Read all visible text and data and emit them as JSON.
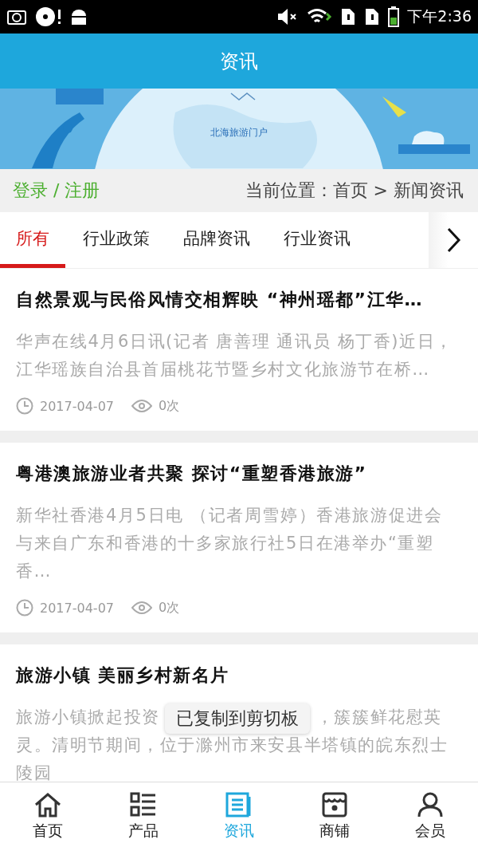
{
  "status_bar": {
    "time": "下午2:36"
  },
  "header": {
    "title": "资讯"
  },
  "banner": {
    "kind": "picture",
    "caption": "北海旅游门户"
  },
  "breadcrumb": {
    "login": "登录 / 注册",
    "location": "当前位置：首页 > 新闻资讯"
  },
  "tabs": [
    {
      "label": "所有",
      "selected": true
    },
    {
      "label": "行业政策",
      "selected": false
    },
    {
      "label": "品牌资讯",
      "selected": false
    },
    {
      "label": "行业资讯",
      "selected": false
    }
  ],
  "articles": [
    {
      "title": "自然景观与民俗风情交相辉映 “神州瑶都”江华…",
      "summary": "华声在线4月6日讯(记者 唐善理 通讯员 杨丁香)近日，江华瑶族自治县首届桃花节暨乡村文化旅游节在桥…",
      "date": "2017-04-07",
      "views": "0次"
    },
    {
      "title": "粤港澳旅游业者共聚 探讨“重塑香港旅游”",
      "summary": "新华社香港4月5日电 （记者周雪婷）香港旅游促进会与来自广东和香港的十多家旅行社5日在港举办“重塑香…",
      "date": "2017-04-07",
      "views": "0次"
    },
    {
      "title": "旅游小镇 美丽乡村新名片",
      "summary_lines": [
        [
          "旅游小镇掀起投资",
          "，簇簇鲜花慰英"
        ],
        [
          "灵。清明节期间，位于滁州市来安县半塔镇的皖东烈士陵园"
        ]
      ],
      "toast": "已复制到剪切板"
    }
  ],
  "bottom_nav": [
    {
      "label": "首页",
      "kind": "home",
      "selected": false
    },
    {
      "label": "产品",
      "kind": "grid",
      "selected": false
    },
    {
      "label": "资讯",
      "kind": "news",
      "selected": true
    },
    {
      "label": "商铺",
      "kind": "shop",
      "selected": false
    },
    {
      "label": "会员",
      "kind": "user",
      "selected": false
    }
  ]
}
